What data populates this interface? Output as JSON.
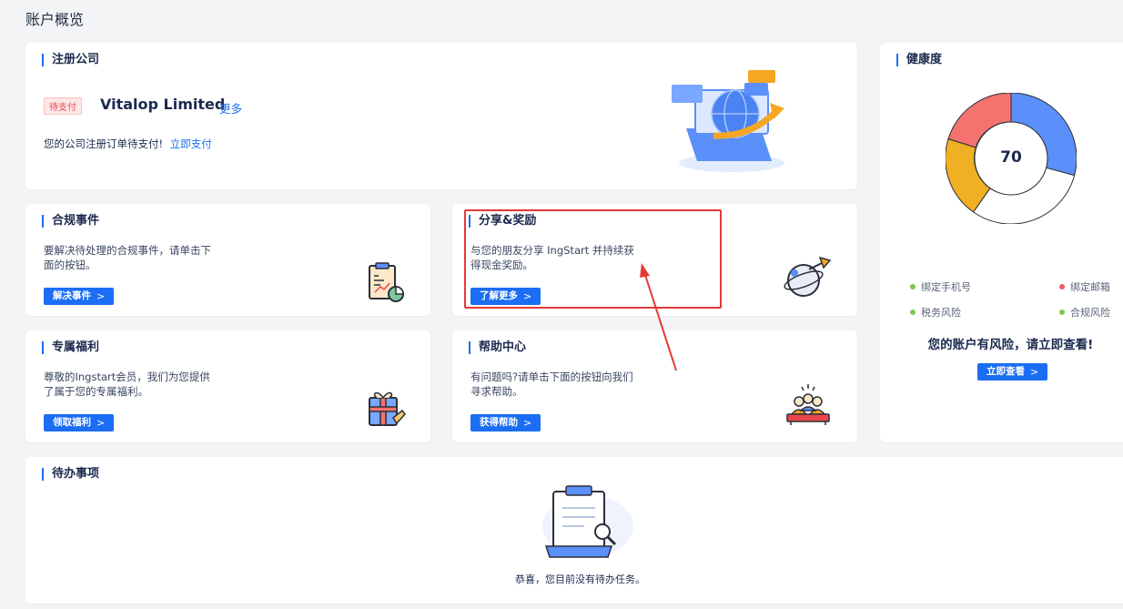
{
  "page_title": "账户概览",
  "company_card": {
    "title": "注册公司",
    "badge": "待支付",
    "company_name": "Vitalop Limited",
    "more_link": "更多",
    "message": "您的公司注册订单待支付!",
    "pay_link": "立即支付"
  },
  "compliance_card": {
    "title": "合规事件",
    "desc_line1": "要解决待处理的合规事件，请单击下",
    "desc_line2": "面的按钮。",
    "button": "解决事件",
    "icon": "clipboard-chart-icon"
  },
  "share_card": {
    "title": "分享&奖励",
    "desc_line1": "与您的朋友分享 IngStart 并持续获",
    "desc_line2": "得现金奖励。",
    "button": "了解更多",
    "icon": "planet-arrow-icon"
  },
  "benefits_card": {
    "title": "专属福利",
    "desc_line1": "尊敬的Ingstart会员，我们为您提供",
    "desc_line2": "了属于您的专属福利。",
    "button": "领取福利",
    "icon": "gift-box-icon"
  },
  "help_card": {
    "title": "帮助中心",
    "desc_line1": "有问题吗?请单击下面的按钮向我们",
    "desc_line2": "寻求帮助。",
    "button": "获得帮助",
    "icon": "team-help-icon"
  },
  "health_card": {
    "title": "健康度",
    "score": "70",
    "legend": [
      {
        "label": "绑定手机号",
        "color": "#7ec850"
      },
      {
        "label": "绑定邮箱",
        "color": "#f05b5b"
      },
      {
        "label": "税务风险",
        "color": "#7ec850"
      },
      {
        "label": "合规风险",
        "color": "#7ec850"
      }
    ],
    "warning": "您的账户有风险，请立即查看!",
    "button": "立即查看",
    "segment_colors": [
      "#5b8ff9",
      "#ffffff",
      "#f0b024",
      "#f4736e"
    ]
  },
  "todo_card": {
    "title": "待办事项",
    "empty_message": "恭喜，您目前没有待办任务。"
  },
  "chevron": ">"
}
